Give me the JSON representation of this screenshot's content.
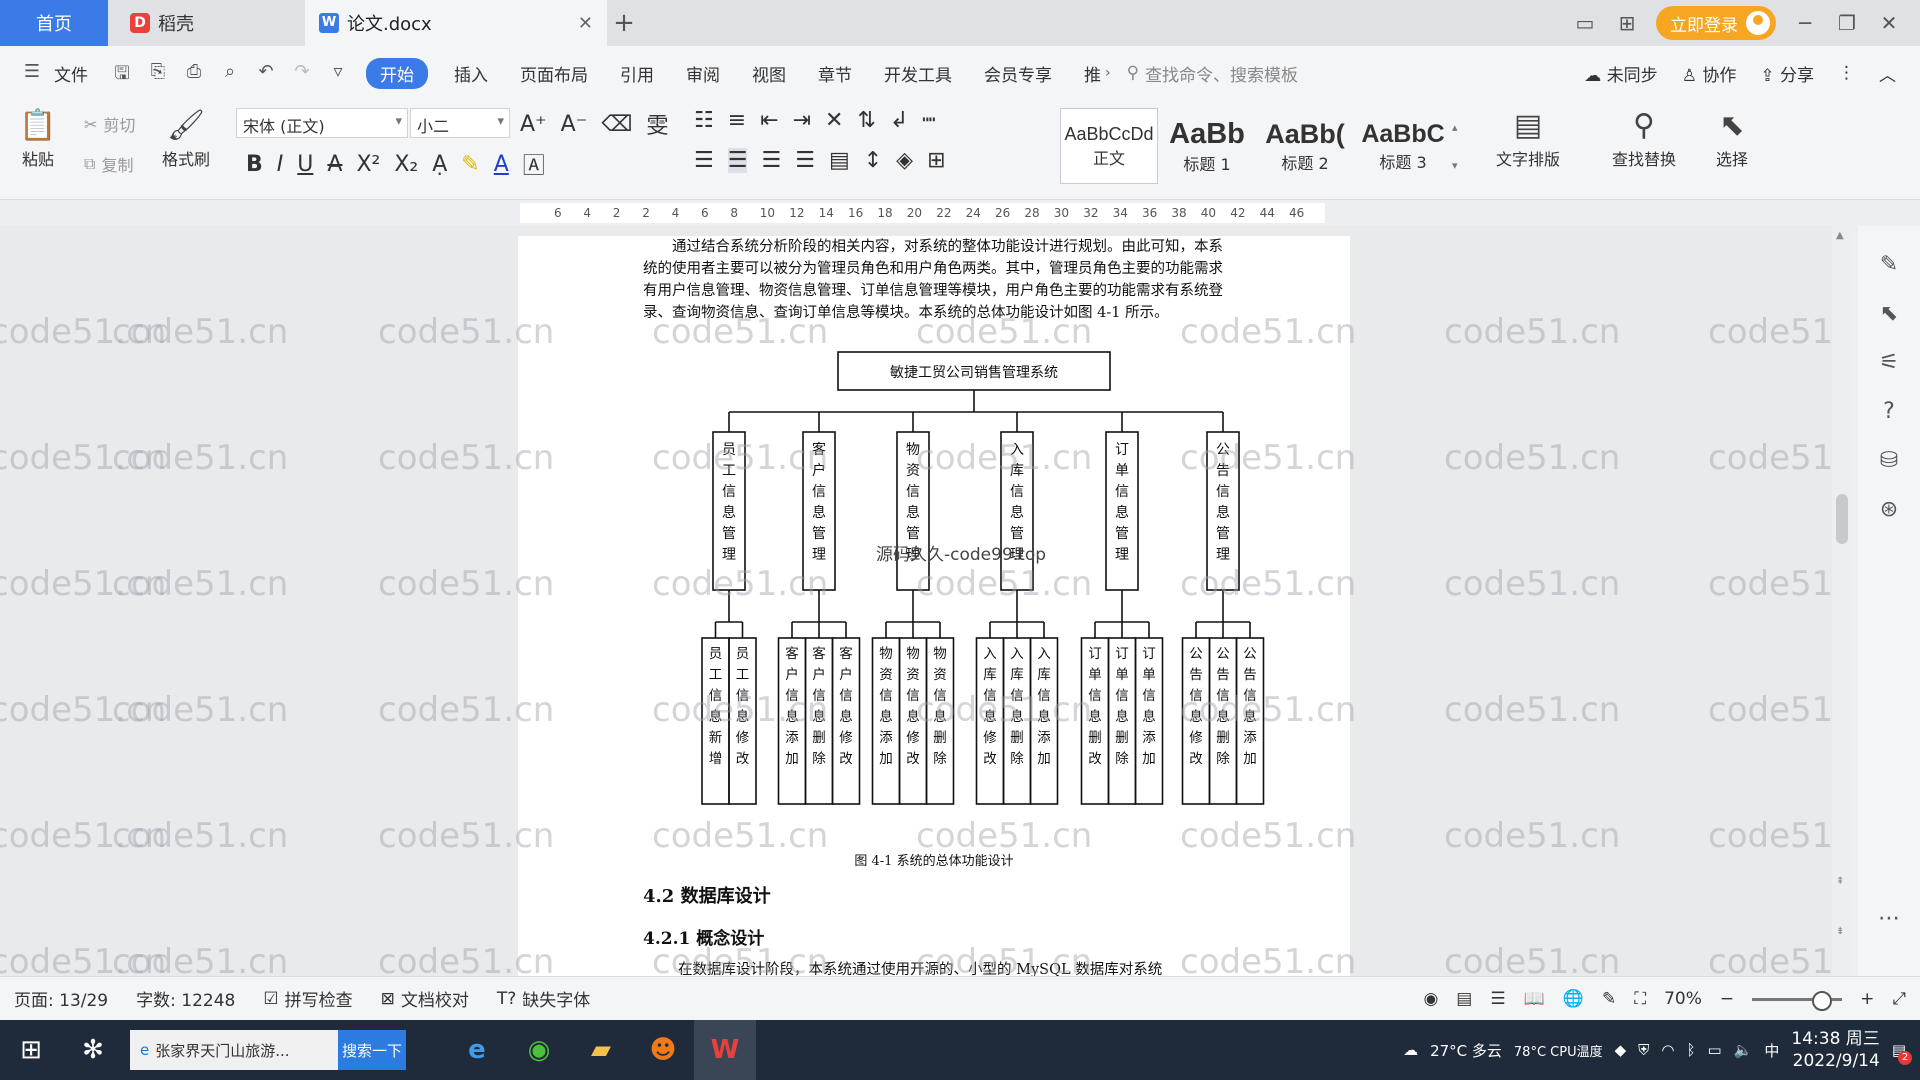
{
  "tabs": {
    "home": "首页",
    "daoke": "稻壳",
    "document": "论文.docx",
    "new_tab": "+"
  },
  "titlebar": {
    "login": "立即登录"
  },
  "menu": {
    "file": "文件",
    "items": [
      "开始",
      "插入",
      "页面布局",
      "引用",
      "审阅",
      "视图",
      "章节",
      "开发工具",
      "会员专享",
      "推"
    ],
    "search_cmd": "查找命令、搜索模板",
    "unsynced": "未同步",
    "collab": "协作",
    "share": "分享"
  },
  "ribbon": {
    "paste": "粘贴",
    "cut": "剪切",
    "copy": "复制",
    "format_painter": "格式刷",
    "font": "宋体 (正文)",
    "size": "小二",
    "styles": [
      {
        "sample": "AaBbCcDd",
        "label": "正文"
      },
      {
        "sample": "AaBb",
        "label": "标题 1"
      },
      {
        "sample": "AaBb(",
        "label": "标题 2"
      },
      {
        "sample": "AaBbC",
        "label": "标题 3"
      }
    ],
    "text_layout": "文字排版",
    "find_replace": "查找替换",
    "select": "选择"
  },
  "ruler": {
    "ticks": [
      "6",
      "4",
      "2",
      "2",
      "4",
      "6",
      "8",
      "10",
      "12",
      "14",
      "16",
      "18",
      "20",
      "22",
      "24",
      "26",
      "28",
      "30",
      "32",
      "34",
      "36",
      "38",
      "40",
      "42",
      "44",
      "46"
    ]
  },
  "document": {
    "intro": "通过结合系统分析阶段的相关内容，对系统的整体功能设计进行规划。由此可知，本系统的使用者主要可以被分为管理员角色和用户角色两类。其中，管理员角色主要的功能需求有用户信息管理、物资信息管理、订单信息管理等模块，用户角色主要的功能需求有系统登录、查询物资信息、查询订单信息等模块。本系统的总体功能设计如图 4-1 所示。",
    "diagram": {
      "root": "敏捷工贸公司销售管理系统",
      "modules": [
        {
          "name": "员工信息管理",
          "children": [
            "员工信息新增",
            "员工信息修改"
          ]
        },
        {
          "name": "客户信息管理",
          "children": [
            "客户信息添加",
            "客户信息删除",
            "客户信息修改"
          ]
        },
        {
          "name": "物资信息管理",
          "children": [
            "物资信息添加",
            "物资信息修改",
            "物资信息删除"
          ]
        },
        {
          "name": "入库信息管理",
          "children": [
            "入库信息修改",
            "入库信息删除",
            "入库信息添加"
          ]
        },
        {
          "name": "订单信息管理",
          "children": [
            "订单信息删改",
            "订单信息删除",
            "订单信息添加"
          ]
        },
        {
          "name": "公告信息管理",
          "children": [
            "公告信息修改",
            "公告信息删除",
            "公告信息添加"
          ]
        }
      ]
    },
    "caption": "图 4-1 系统的总体功能设计",
    "h42": "4.2 数据库设计",
    "h421": "4.2.1 概念设计",
    "para_start": "在数据库设计阶段，本系统通过使用开源的、小型的 MySQL 数据库对系统",
    "overlay": "源码久久-code99.top",
    "watermark": "code51.cn"
  },
  "status": {
    "page": "页面: 13/29",
    "words": "字数: 12248",
    "spell": "拼写检查",
    "proof": "文档校对",
    "missing_font": "缺失字体",
    "zoom": "70%"
  },
  "taskbar": {
    "search_text": "张家界天门山旅游...",
    "search_btn": "搜索一下",
    "weather": "27°C 多云",
    "cpu": "78°C CPU温度",
    "ime": "中",
    "time": "14:38 周三",
    "date": "2022/9/14",
    "badge": "2"
  }
}
